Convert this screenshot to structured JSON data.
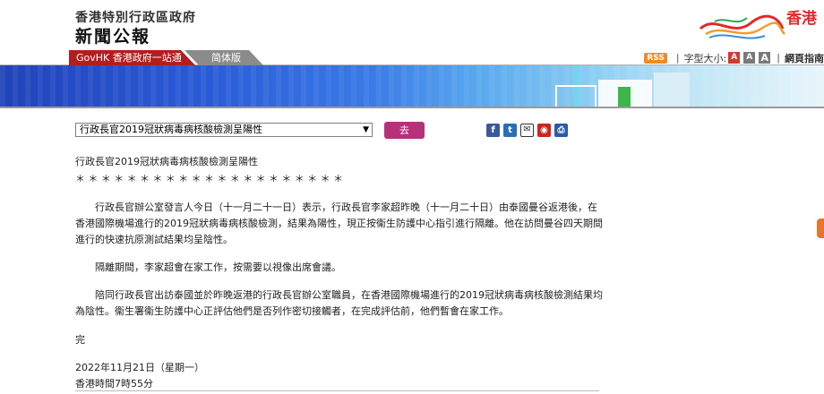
{
  "header": {
    "org": "香港特別行政區政府",
    "title": "新聞公報",
    "logo_text": "香港"
  },
  "nav": {
    "govhk": "GovHK 香港政府一站通",
    "simplified": "简体版",
    "rss": "RSS",
    "font_size_label": "字型大小:",
    "font_sizes": [
      "A",
      "A",
      "A"
    ],
    "sitemap": "網頁指南"
  },
  "toolbar": {
    "select_value": "行政長官2019冠狀病毒病核酸檢測呈陽性",
    "go_label": "去",
    "share_icons": [
      "facebook-icon",
      "twitter-icon",
      "email-icon",
      "weibo-icon",
      "print-icon"
    ]
  },
  "article": {
    "headline": "行政長官2019冠狀病毒病核酸檢測呈陽性",
    "stars": "＊＊＊＊＊＊＊＊＊＊＊＊＊＊＊＊＊＊＊＊＊",
    "paragraphs": [
      "行政長官辦公室發言人今日（十一月二十一日）表示，行政長官李家超昨晚（十一月二十日）由泰國曼谷返港後，在香港國際機場進行的2019冠狀病毒病核酸檢測，結果為陽性，現正按衞生防護中心指引進行隔離。他在訪問曼谷四天期間進行的快速抗原測試結果均呈陰性。",
      "隔離期間，李家超會在家工作，按需要以視像出席會議。",
      "陪同行政長官出訪泰國並於昨晚返港的行政長官辦公室職員，在香港國際機場進行的2019冠狀病毒病核酸檢測結果均為陰性。衞生署衞生防護中心正評估他們是否列作密切接觸者，在完成評估前，他們暫會在家工作。"
    ],
    "end": "完",
    "date": "2022年11月21日（星期一）",
    "time": "香港時間7時55分"
  },
  "colors": {
    "govhk_tab": "#b51d1d",
    "go_button": "#b5317a",
    "logo_red": "#e2282a"
  }
}
